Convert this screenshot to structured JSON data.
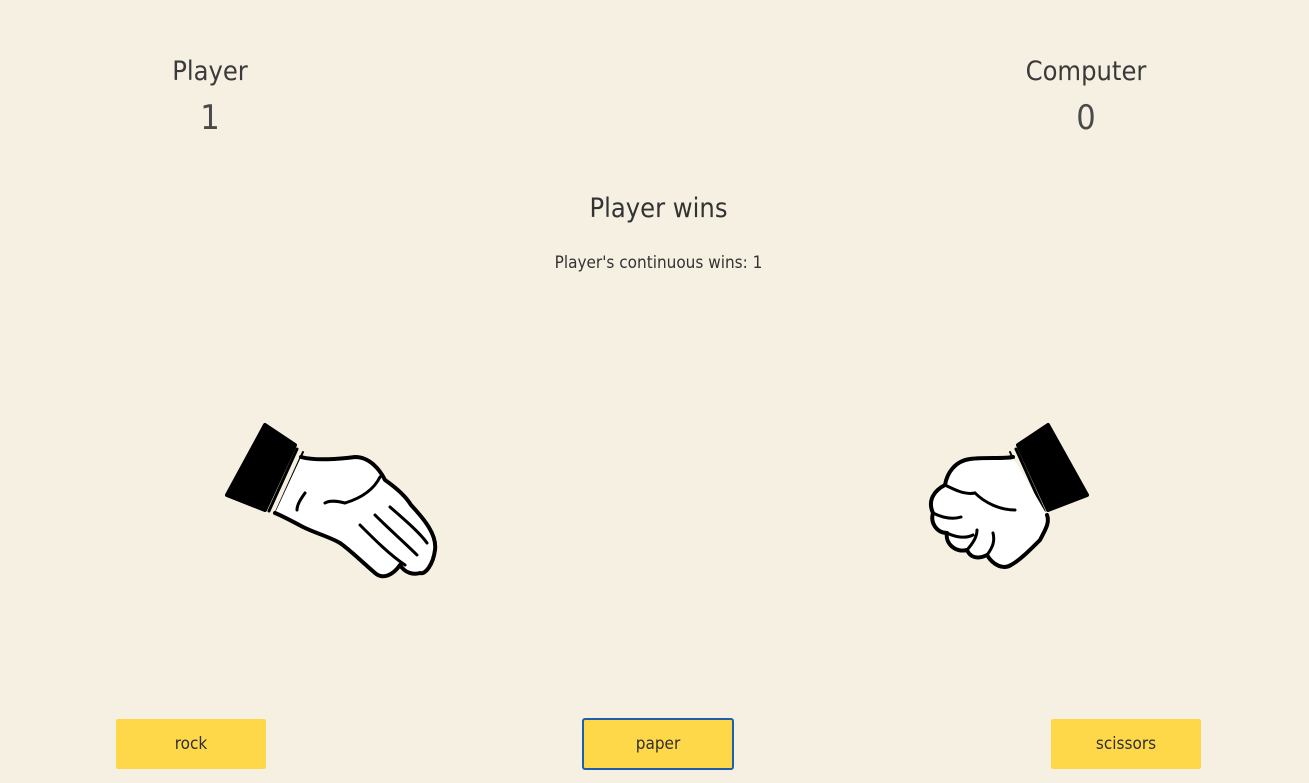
{
  "scoreboard": {
    "player": {
      "label": "Player",
      "score": "1"
    },
    "computer": {
      "label": "Computer",
      "score": "0"
    }
  },
  "result": {
    "message": "Player wins",
    "streak_text": "Player's continuous wins: 1"
  },
  "hands": {
    "player": {
      "icon": "open-hand-icon",
      "choice": "paper"
    },
    "computer": {
      "icon": "fist-icon",
      "choice": "rock"
    }
  },
  "choices": [
    {
      "label": "rock"
    },
    {
      "label": "paper",
      "focused": true
    },
    {
      "label": "scissors"
    }
  ],
  "colors": {
    "background": "#f5f0e1",
    "button": "#ffd84a",
    "focus_ring": "#1f5fa8",
    "text": "#333333"
  }
}
